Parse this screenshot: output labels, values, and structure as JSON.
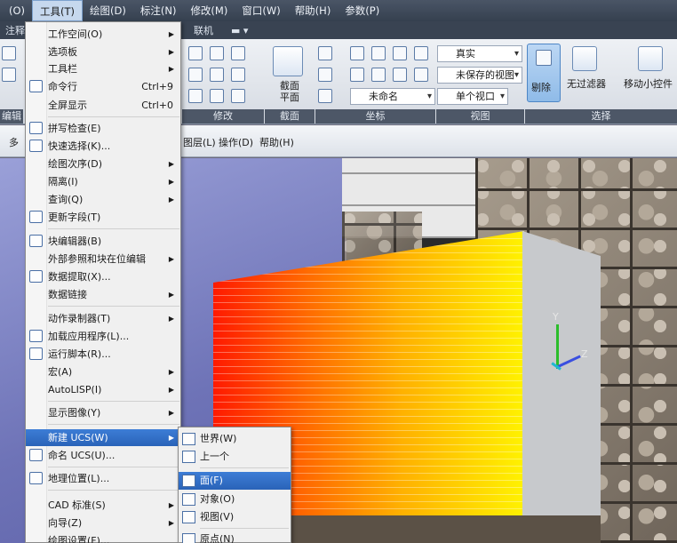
{
  "menubar": [
    "(O)",
    "工具(T)",
    "绘图(D)",
    "标注(N)",
    "修改(M)",
    "窗口(W)",
    "帮助(H)",
    "参数(P)"
  ],
  "ribbon_tabs": [
    "注释",
    "联机"
  ],
  "ribbon": {
    "section_button": "截面\n平面",
    "visual_style": "真实",
    "saved_view": "未保存的视图",
    "named_view": "未命名",
    "viewport": "单个视口",
    "isolate": "剔除",
    "filter": "无过滤器",
    "gizmo": "移动小控件",
    "panels": [
      "编辑",
      "修改",
      "截面",
      "坐标",
      "视图",
      "选择"
    ]
  },
  "toolbar2": [
    "多",
    "图层(L)",
    "操作(D)",
    "帮助(H)"
  ],
  "tools_menu": [
    {
      "label": "工作空间(O)",
      "arrow": true
    },
    {
      "label": "选项板",
      "arrow": true
    },
    {
      "label": "工具栏",
      "arrow": true
    },
    {
      "label": "命令行",
      "shortcut": "Ctrl+9"
    },
    {
      "label": "全屏显示",
      "shortcut": "Ctrl+0"
    },
    {
      "label": "拼写检查(E)"
    },
    {
      "label": "快速选择(K)..."
    },
    {
      "label": "绘图次序(D)",
      "arrow": true
    },
    {
      "label": "隔离(I)",
      "arrow": true
    },
    {
      "label": "查询(Q)",
      "arrow": true
    },
    {
      "label": "更新字段(T)"
    },
    {
      "label": "块编辑器(B)"
    },
    {
      "label": "外部参照和块在位编辑",
      "arrow": true
    },
    {
      "label": "数据提取(X)..."
    },
    {
      "label": "数据链接",
      "arrow": true
    },
    {
      "label": "动作录制器(T)",
      "arrow": true
    },
    {
      "label": "加载应用程序(L)..."
    },
    {
      "label": "运行脚本(R)..."
    },
    {
      "label": "宏(A)",
      "arrow": true
    },
    {
      "label": "AutoLISP(I)",
      "arrow": true
    },
    {
      "label": "显示图像(Y)",
      "arrow": true
    },
    {
      "label": "新建 UCS(W)",
      "arrow": true
    },
    {
      "label": "命名 UCS(U)..."
    },
    {
      "label": "地理位置(L)..."
    },
    {
      "label": "CAD 标准(S)",
      "arrow": true
    },
    {
      "label": "向导(Z)",
      "arrow": true
    },
    {
      "label": "绘图设置(F)..."
    }
  ],
  "ucs_submenu": [
    "世界(W)",
    "上一个",
    "面(F)",
    "对象(O)",
    "视图(V)",
    "原点(N)"
  ],
  "axis_labels": {
    "y": "Y",
    "z": "Z"
  },
  "colors": {
    "menu_highlight": "#2a63b8",
    "face_start": "#ff1a00",
    "face_end": "#fff200"
  }
}
